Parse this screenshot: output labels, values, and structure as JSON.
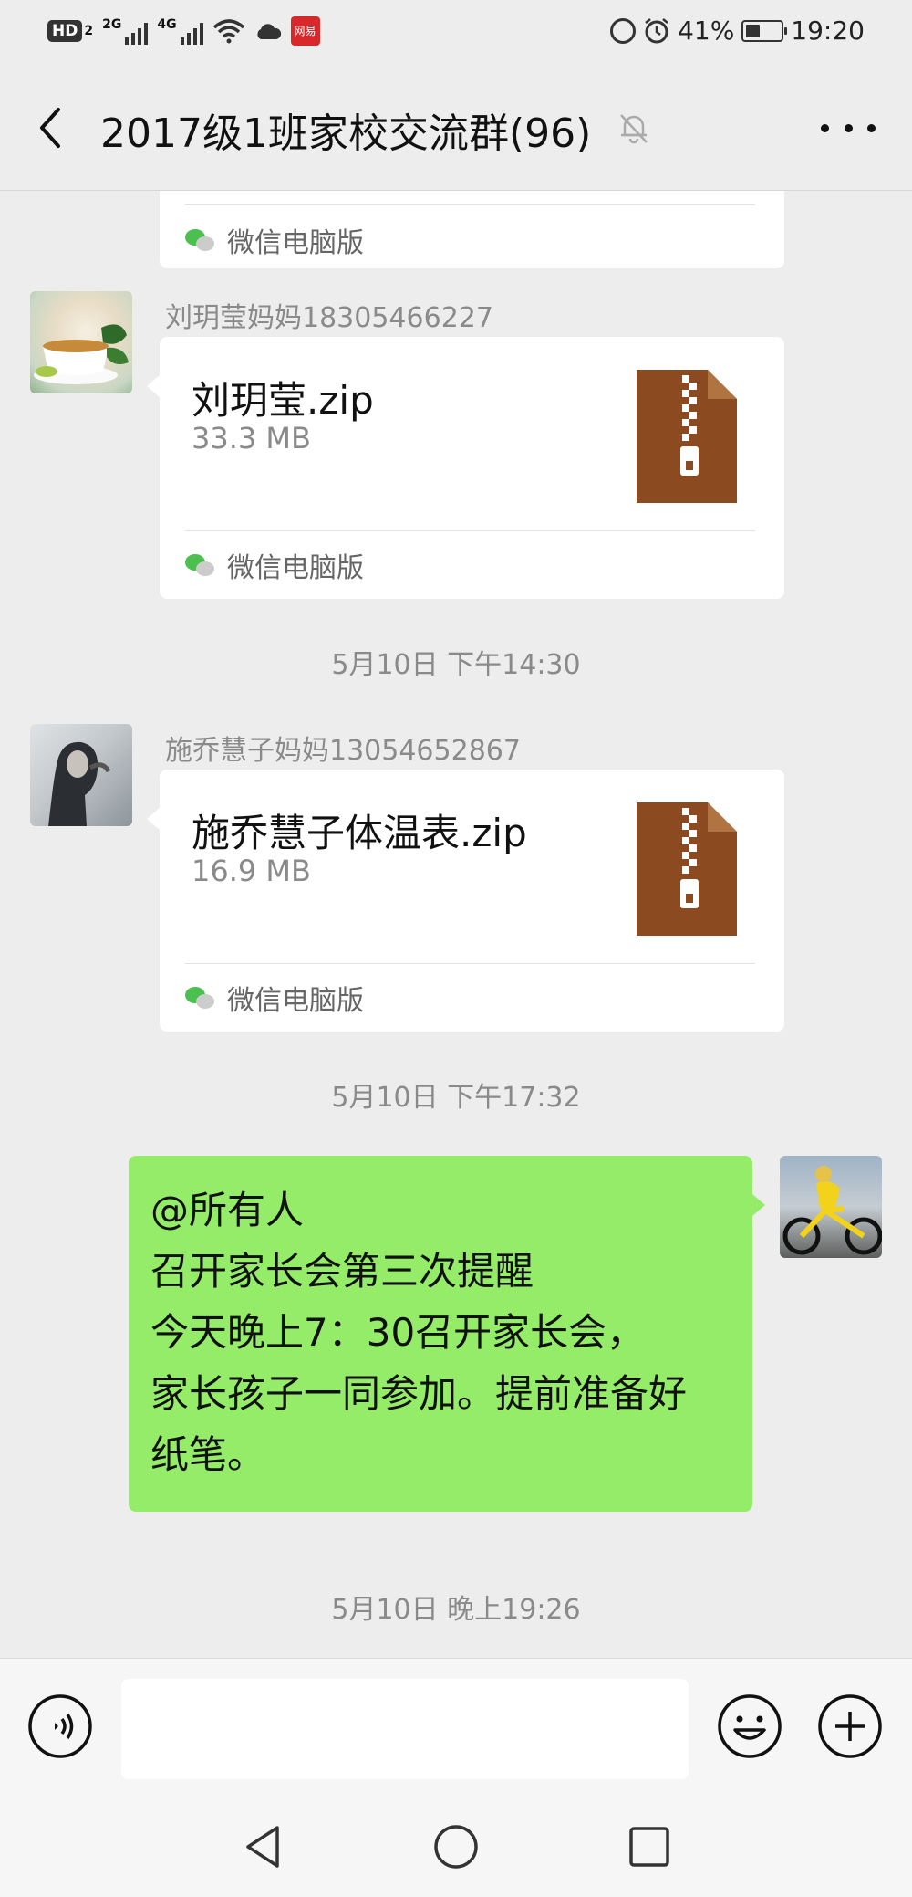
{
  "status_bar": {
    "hd_label": "HD",
    "hd_sub": "2",
    "net1": "2G",
    "net2": "4G",
    "app_badge": "网易",
    "battery": "41%",
    "battery_level": 0.41,
    "time": "19:20",
    "icons": [
      "hd-icon",
      "signal-icon",
      "wifi-icon",
      "cloud-icon",
      "vpn-icon",
      "alarm-icon",
      "battery-icon"
    ]
  },
  "header": {
    "title": "2017级1班家校交流群(96)",
    "back_icon": "chevron-left-icon",
    "mute_icon": "bell-muted-icon",
    "more_icon": "more-dots-icon"
  },
  "messages": [
    {
      "type": "file-partial",
      "source": "微信电脑版"
    },
    {
      "type": "file",
      "sender": "刘玥莹妈妈18305466227",
      "file_name": "刘玥莹.zip",
      "file_size": "33.3 MB",
      "source": "微信电脑版",
      "file_icon": "zip-file-icon"
    },
    {
      "type": "time",
      "text": "5月10日 下午14:30"
    },
    {
      "type": "file",
      "sender": "施乔慧子妈妈13054652867",
      "file_name": "施乔慧子体温表.zip",
      "file_size": "16.9 MB",
      "source": "微信电脑版",
      "file_icon": "zip-file-icon"
    },
    {
      "type": "time",
      "text": "5月10日 下午17:32"
    },
    {
      "type": "text-self",
      "lines": [
        "@所有人",
        "召开家长会第三次提醒",
        "今天晚上7：30召开家长会，",
        "家长孩子一同参加。提前准备好",
        "纸笔。"
      ]
    },
    {
      "type": "time",
      "text": "5月10日 晚上19:26"
    }
  ],
  "input_bar": {
    "voice_icon": "voice-input-icon",
    "emoji_icon": "emoji-icon",
    "plus_icon": "plus-icon",
    "text_value": ""
  },
  "nav_bar": {
    "icons": [
      "nav-back-icon",
      "nav-home-icon",
      "nav-recents-icon"
    ]
  },
  "colors": {
    "background": "#ededed",
    "self_bubble": "#95ec69",
    "zip_icon": "#8b4a1f",
    "wechat_green": "#4cc04f"
  }
}
